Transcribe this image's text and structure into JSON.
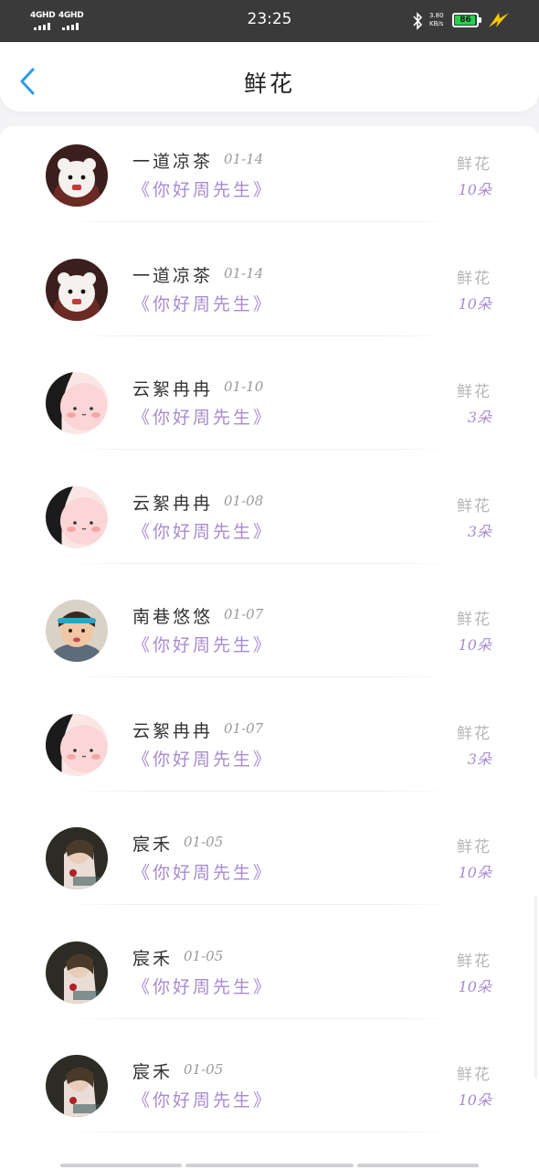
{
  "status_bar": {
    "signal_1": "4GHD",
    "signal_2": "4GHD",
    "time": "23:25",
    "speed_value": "3.80",
    "speed_unit": "KB/s",
    "battery": "86",
    "icons": [
      "bluetooth-icon",
      "battery-icon",
      "charging-icon"
    ]
  },
  "header": {
    "title": "鲜花",
    "back_icon": "chevron-left-icon",
    "accent": "#2f9be6"
  },
  "colors": {
    "work_text": "#a78bd0",
    "gift_text": "#b6b6b6",
    "date_text": "#9a9a9a"
  },
  "records": [
    {
      "name": "一道凉茶",
      "date": "01-14",
      "work": "《你好周先生》",
      "gift": "鲜花",
      "count": "10朵",
      "avatar": "white-bear-avatar"
    },
    {
      "name": "一道凉茶",
      "date": "01-14",
      "work": "《你好周先生》",
      "gift": "鲜花",
      "count": "10朵",
      "avatar": "white-bear-avatar"
    },
    {
      "name": "云絮冉冉",
      "date": "01-10",
      "work": "《你好周先生》",
      "gift": "鲜花",
      "count": "3朵",
      "avatar": "pink-cartoon-avatar"
    },
    {
      "name": "云絮冉冉",
      "date": "01-08",
      "work": "《你好周先生》",
      "gift": "鲜花",
      "count": "3朵",
      "avatar": "pink-cartoon-avatar"
    },
    {
      "name": "南巷悠悠",
      "date": "01-07",
      "work": "《你好周先生》",
      "gift": "鲜花",
      "count": "10朵",
      "avatar": "child-photo-avatar"
    },
    {
      "name": "云絮冉冉",
      "date": "01-07",
      "work": "《你好周先生》",
      "gift": "鲜花",
      "count": "3朵",
      "avatar": "pink-cartoon-avatar"
    },
    {
      "name": "宸禾",
      "date": "01-05",
      "work": "《你好周先生》",
      "gift": "鲜花",
      "count": "10朵",
      "avatar": "girl-photo-avatar"
    },
    {
      "name": "宸禾",
      "date": "01-05",
      "work": "《你好周先生》",
      "gift": "鲜花",
      "count": "10朵",
      "avatar": "girl-photo-avatar"
    },
    {
      "name": "宸禾",
      "date": "01-05",
      "work": "《你好周先生》",
      "gift": "鲜花",
      "count": "10朵",
      "avatar": "girl-photo-avatar"
    }
  ]
}
